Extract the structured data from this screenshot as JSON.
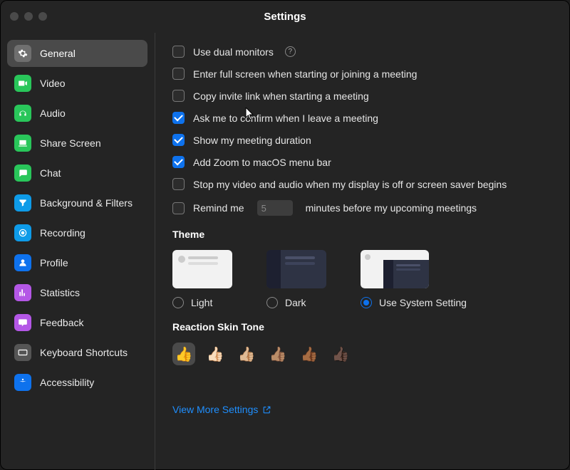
{
  "window": {
    "title": "Settings"
  },
  "sidebar": {
    "items": [
      {
        "label": "General",
        "icon": "gear",
        "bg": "#6f6f6f",
        "active": true
      },
      {
        "label": "Video",
        "icon": "video",
        "bg": "#29c65a",
        "active": false
      },
      {
        "label": "Audio",
        "icon": "audio",
        "bg": "#29c65a",
        "active": false
      },
      {
        "label": "Share Screen",
        "icon": "share",
        "bg": "#29c65a",
        "active": false
      },
      {
        "label": "Chat",
        "icon": "chat",
        "bg": "#29c65a",
        "active": false
      },
      {
        "label": "Background & Filters",
        "icon": "filters",
        "bg": "#0e9be8",
        "active": false
      },
      {
        "label": "Recording",
        "icon": "record",
        "bg": "#0e9be8",
        "active": false
      },
      {
        "label": "Profile",
        "icon": "profile",
        "bg": "#0e72ed",
        "active": false
      },
      {
        "label": "Statistics",
        "icon": "stats",
        "bg": "#b457e6",
        "active": false
      },
      {
        "label": "Feedback",
        "icon": "feedback",
        "bg": "#b457e6",
        "active": false
      },
      {
        "label": "Keyboard Shortcuts",
        "icon": "keyboard",
        "bg": "#555555",
        "active": false
      },
      {
        "label": "Accessibility",
        "icon": "a11y",
        "bg": "#0e72ed",
        "active": false
      }
    ]
  },
  "general": {
    "options": [
      {
        "label": "Use dual monitors",
        "checked": false,
        "help": true
      },
      {
        "label": "Enter full screen when starting or joining a meeting",
        "checked": false
      },
      {
        "label": "Copy invite link when starting a meeting",
        "checked": false
      },
      {
        "label": "Ask me to confirm when I leave a meeting",
        "checked": true
      },
      {
        "label": "Show my meeting duration",
        "checked": true
      },
      {
        "label": "Add Zoom to macOS menu bar",
        "checked": true
      },
      {
        "label": "Stop my video and audio when my display is off or screen saver begins",
        "checked": false
      }
    ],
    "remind": {
      "prefix": "Remind me",
      "value": "5",
      "suffix": "minutes before my upcoming meetings",
      "checked": false
    },
    "theme": {
      "title": "Theme",
      "options": [
        {
          "label": "Light",
          "selected": false
        },
        {
          "label": "Dark",
          "selected": false
        },
        {
          "label": "Use System Setting",
          "selected": true
        }
      ]
    },
    "skin": {
      "title": "Reaction Skin Tone",
      "tones": [
        "👍",
        "👍🏻",
        "👍🏼",
        "👍🏽",
        "👍🏾",
        "👍🏿"
      ],
      "selected_index": 0
    },
    "link": "View More Settings"
  }
}
